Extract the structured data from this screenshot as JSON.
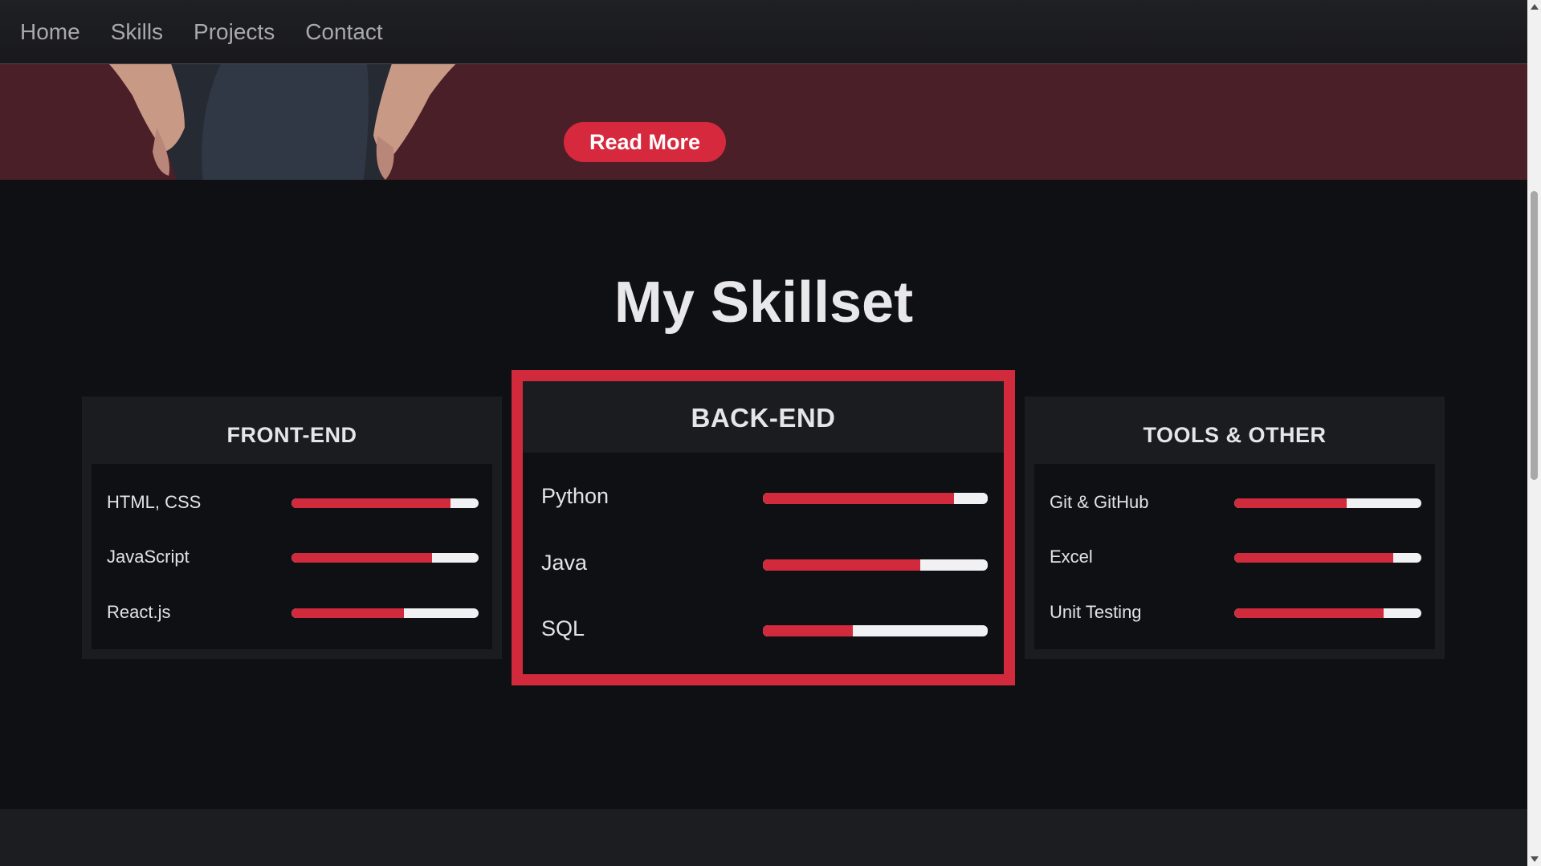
{
  "nav": {
    "items": [
      "Home",
      "Skills",
      "Projects",
      "Contact"
    ]
  },
  "hero": {
    "read_more_label": "Read More",
    "colors": {
      "background": "#4b1f28",
      "button": "#d6293d"
    }
  },
  "skills": {
    "title": "My Skillset",
    "cards": [
      {
        "title": "FRONT-END",
        "items": [
          {
            "label": "HTML, CSS",
            "level": 0.85
          },
          {
            "label": "JavaScript",
            "level": 0.75
          },
          {
            "label": "React.js",
            "level": 0.6
          }
        ]
      },
      {
        "title": "BACK-END",
        "highlighted": true,
        "items": [
          {
            "label": "Python",
            "level": 0.85
          },
          {
            "label": "Java",
            "level": 0.7
          },
          {
            "label": "SQL",
            "level": 0.4
          }
        ]
      },
      {
        "title": "TOOLS & OTHER",
        "items": [
          {
            "label": "Git & GitHub",
            "level": 0.6
          },
          {
            "label": "Excel",
            "level": 0.85
          },
          {
            "label": "Unit Testing",
            "level": 0.8
          }
        ]
      }
    ],
    "colors": {
      "accent": "#d12a3d",
      "track": "#f1f1f3"
    }
  }
}
